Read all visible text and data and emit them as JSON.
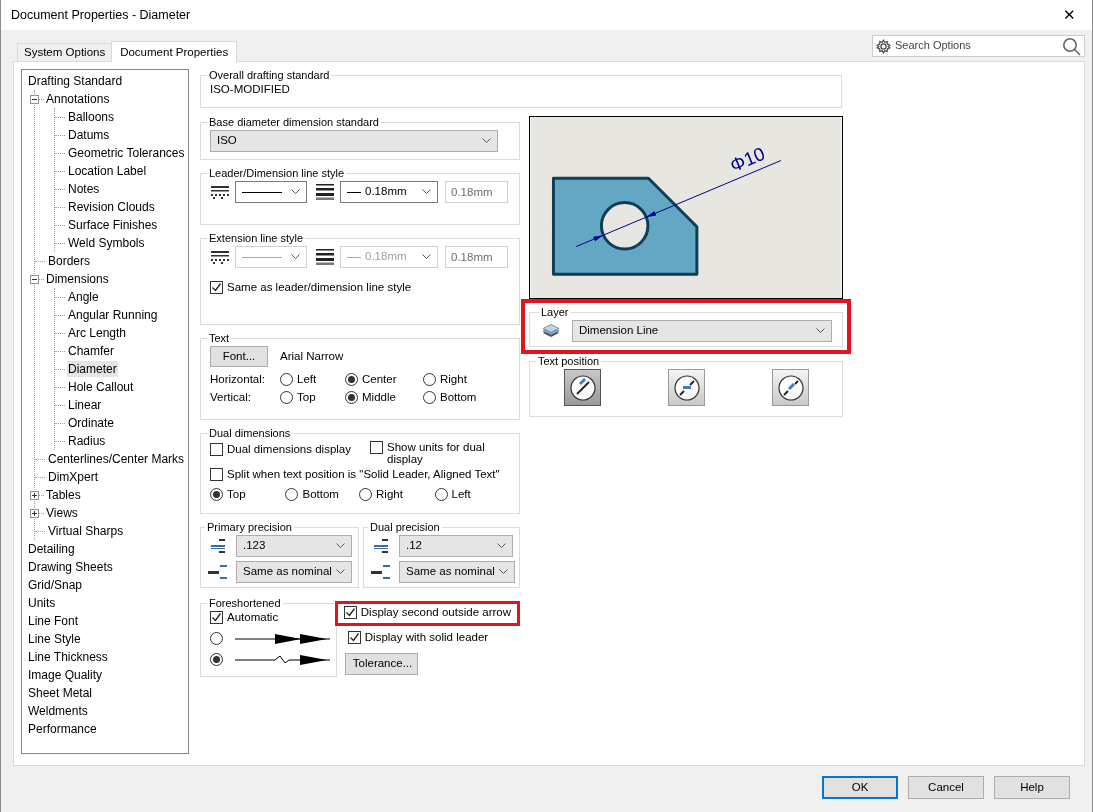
{
  "window": {
    "title": "Document Properties - Diameter",
    "close": "✕"
  },
  "tabs": [
    {
      "label": "System Options",
      "selected": false
    },
    {
      "label": "Document Properties",
      "selected": true
    }
  ],
  "search": {
    "placeholder": "Search Options"
  },
  "tree": [
    {
      "label": "Drafting Standard",
      "selected": false,
      "children": [
        {
          "label": "Annotations",
          "selected": false,
          "expanded": true,
          "children": [
            {
              "label": "Balloons",
              "selected": false
            },
            {
              "label": "Datums",
              "selected": false
            },
            {
              "label": "Geometric Tolerances",
              "selected": false
            },
            {
              "label": "Location Label",
              "selected": false
            },
            {
              "label": "Notes",
              "selected": false
            },
            {
              "label": "Revision Clouds",
              "selected": false
            },
            {
              "label": "Surface Finishes",
              "selected": false
            },
            {
              "label": "Weld Symbols",
              "selected": false
            }
          ]
        },
        {
          "label": "Borders",
          "selected": false
        },
        {
          "label": "Dimensions",
          "selected": false,
          "expanded": true,
          "children": [
            {
              "label": "Angle",
              "selected": false
            },
            {
              "label": "Angular Running",
              "selected": false
            },
            {
              "label": "Arc Length",
              "selected": false
            },
            {
              "label": "Chamfer",
              "selected": false
            },
            {
              "label": "Diameter",
              "selected": true
            },
            {
              "label": "Hole Callout",
              "selected": false
            },
            {
              "label": "Linear",
              "selected": false
            },
            {
              "label": "Ordinate",
              "selected": false
            },
            {
              "label": "Radius",
              "selected": false
            }
          ]
        },
        {
          "label": "Centerlines/Center Marks",
          "selected": false
        },
        {
          "label": "DimXpert",
          "selected": false
        },
        {
          "label": "Tables",
          "selected": false,
          "expanded": false
        },
        {
          "label": "Views",
          "selected": false,
          "expanded": false
        },
        {
          "label": "Virtual Sharps",
          "selected": false
        }
      ]
    },
    {
      "label": "Detailing",
      "selected": false
    },
    {
      "label": "Drawing Sheets",
      "selected": false
    },
    {
      "label": "Grid/Snap",
      "selected": false
    },
    {
      "label": "Units",
      "selected": false
    },
    {
      "label": "Line Font",
      "selected": false
    },
    {
      "label": "Line Style",
      "selected": false
    },
    {
      "label": "Line Thickness",
      "selected": false
    },
    {
      "label": "Image Quality",
      "selected": false
    },
    {
      "label": "Sheet Metal",
      "selected": false
    },
    {
      "label": "Weldments",
      "selected": false
    },
    {
      "label": "Performance",
      "selected": false
    }
  ],
  "overall_standard": {
    "title": "Overall drafting standard",
    "value": "ISO-MODIFIED"
  },
  "base_standard": {
    "title": "Base diameter dimension standard",
    "value": "ISO"
  },
  "leader_style": {
    "title": "Leader/Dimension line style",
    "thickness": "0.18mm",
    "custom": "0.18mm",
    "disabled": false
  },
  "extension_style": {
    "title": "Extension line style",
    "thickness": "0.18mm",
    "custom": "0.18mm",
    "disabled": true,
    "same_as_leader": {
      "label": "Same as leader/dimension line style",
      "checked": true
    }
  },
  "text": {
    "title": "Text",
    "font_button": "Font...",
    "font_name": "Arial Narrow",
    "rows": [
      {
        "label": "Horizontal:",
        "options": [
          {
            "label": "Left",
            "selected": false
          },
          {
            "label": "Center",
            "selected": true
          },
          {
            "label": "Right",
            "selected": false
          }
        ]
      },
      {
        "label": "Vertical:",
        "options": [
          {
            "label": "Top",
            "selected": false
          },
          {
            "label": "Middle",
            "selected": true
          },
          {
            "label": "Bottom",
            "selected": false
          }
        ]
      }
    ]
  },
  "dual": {
    "title": "Dual dimensions",
    "checks": [
      {
        "label": "Dual dimensions display",
        "checked": false
      },
      {
        "label": "Show units for dual display",
        "checked": false
      },
      {
        "label": "Split when text position is \"Solid Leader, Aligned Text\"",
        "checked": false
      }
    ],
    "positions": [
      {
        "label": "Top",
        "selected": true
      },
      {
        "label": "Bottom",
        "selected": false
      },
      {
        "label": "Right",
        "selected": false
      },
      {
        "label": "Left",
        "selected": false
      }
    ]
  },
  "precision": [
    {
      "title": "Primary precision",
      "value": ".123",
      "tolerance": "Same as nominal"
    },
    {
      "title": "Dual precision",
      "value": ".12",
      "tolerance": "Same as nominal"
    }
  ],
  "foreshortened": {
    "title": "Foreshortened",
    "automatic": {
      "label": "Automatic",
      "checked": true
    },
    "options": [
      {
        "kind": "double-arrow",
        "selected": false
      },
      {
        "kind": "zigzag",
        "selected": true
      }
    ]
  },
  "arrow_options": [
    {
      "label": "Display second outside arrow",
      "checked": true,
      "highlighted": true
    },
    {
      "label": "Display with solid leader",
      "checked": true,
      "highlighted": false
    }
  ],
  "tolerance_button": "Tolerance...",
  "preview": {
    "dimension_text": "Φ10"
  },
  "layer": {
    "title": "Layer",
    "value": "Dimension Line",
    "highlighted": true
  },
  "text_position": {
    "title": "Text position",
    "options": [
      {
        "kind": "above",
        "selected": true
      },
      {
        "kind": "inline",
        "selected": false
      },
      {
        "kind": "aligned",
        "selected": false
      }
    ]
  },
  "buttons": [
    {
      "label": "OK",
      "default": true
    },
    {
      "label": "Cancel",
      "default": false
    },
    {
      "label": "Help",
      "default": false
    }
  ]
}
